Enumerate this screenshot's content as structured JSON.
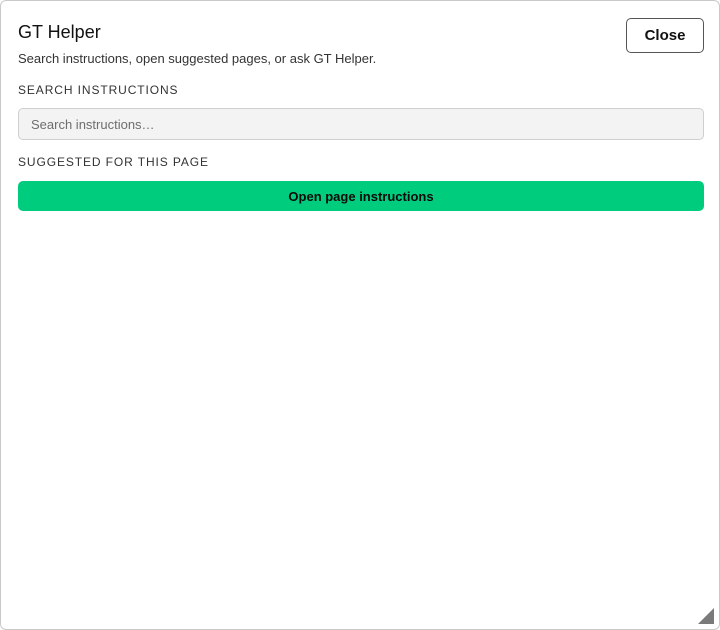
{
  "dialog": {
    "title": "GT Helper",
    "subtitle": "Search instructions, open suggested pages, or ask GT Helper.",
    "close_label": "Close"
  },
  "search": {
    "section_label": "SEARCH INSTRUCTIONS",
    "placeholder": "Search instructions…",
    "value": ""
  },
  "suggested": {
    "section_label": "SUGGESTED FOR THIS PAGE",
    "items": [
      {
        "label": "Open page instructions"
      }
    ]
  },
  "colors": {
    "accent": "#00cc7e",
    "input_bg": "#f3f3f3",
    "border": "#c9c9c9"
  },
  "icons": {
    "resize_grip": "resize-grip-icon"
  }
}
